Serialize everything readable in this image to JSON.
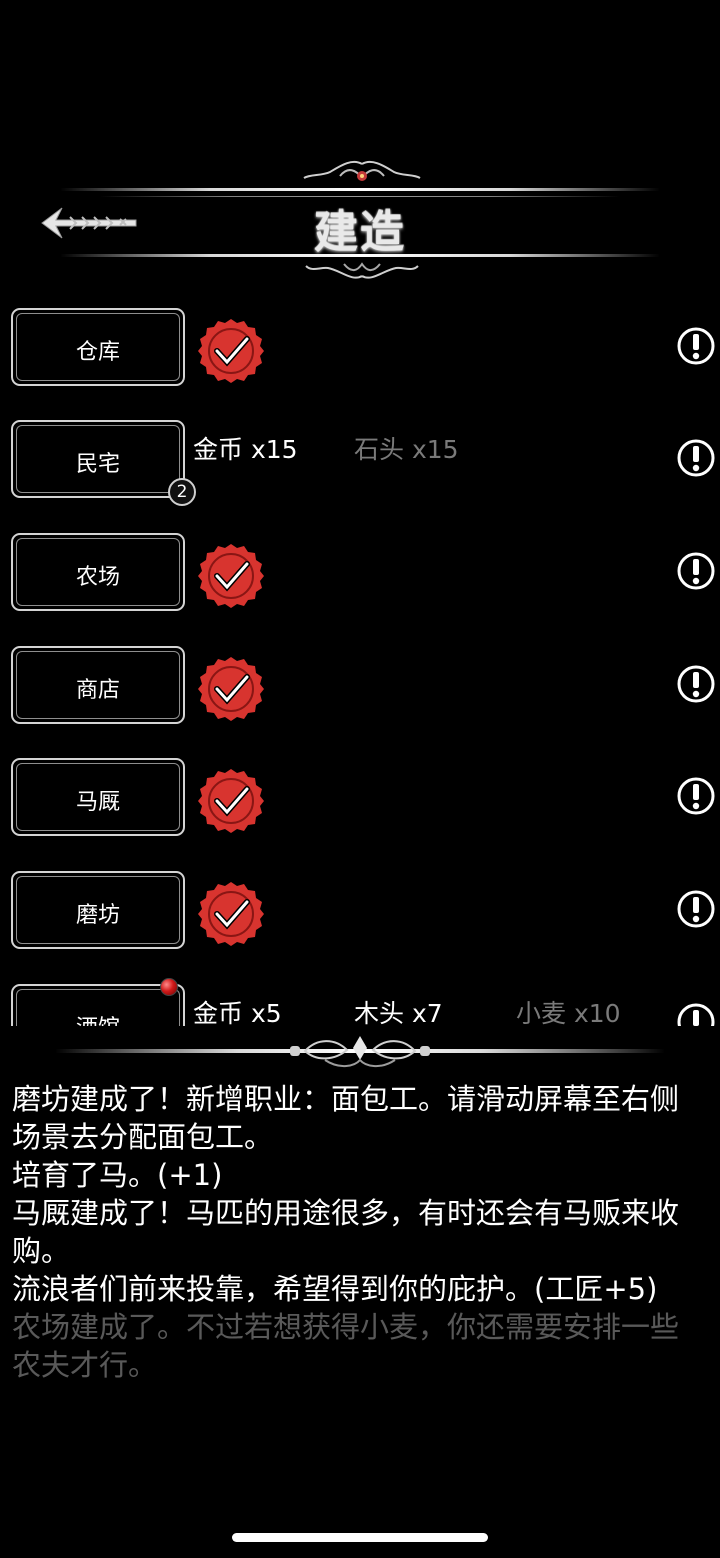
{
  "header": {
    "title": "建造",
    "back_icon": "arrow-left-icon"
  },
  "buildings": [
    {
      "name": "仓库",
      "state": "built"
    },
    {
      "name": "民宅",
      "state": "cost",
      "count": "2",
      "costs": [
        {
          "text": "金币 x15",
          "enough": true
        },
        {
          "text": "石头 x15",
          "enough": false
        }
      ]
    },
    {
      "name": "农场",
      "state": "built"
    },
    {
      "name": "商店",
      "state": "built"
    },
    {
      "name": "马厩",
      "state": "built"
    },
    {
      "name": "磨坊",
      "state": "built"
    },
    {
      "name": "酒馆",
      "state": "cost",
      "new": true,
      "costs": [
        {
          "text": "金币 x5",
          "enough": true
        },
        {
          "text": "木头 x7",
          "enough": true
        },
        {
          "text": "小麦 x10",
          "enough": false
        }
      ]
    }
  ],
  "log": [
    "磨坊建成了！新增职业：面包工。请滑动屏幕至右侧场景去分配面包工。",
    "培育了马。(+1)",
    "马厩建成了！马匹的用途很多，有时还会有马贩来收购。",
    "流浪者们前来投靠，希望得到你的庇护。(工匠+5)",
    "农场建成了。不过若想获得小麦，你还需要安排一些农夫才行。"
  ],
  "colors": {
    "background": "#000000",
    "seal_red": "#d8342f",
    "lack_gray": "#7a7a7a",
    "text": "#ffffff"
  }
}
